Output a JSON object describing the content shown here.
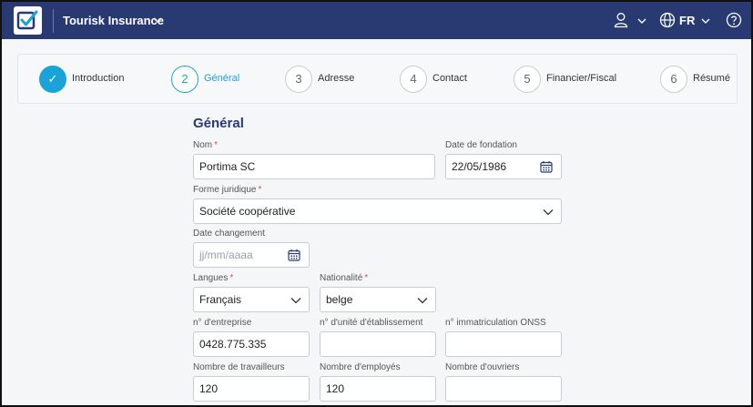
{
  "header": {
    "brand": "Tourisk Insurance",
    "language": "FR"
  },
  "stepper": {
    "steps": [
      {
        "number": "✓",
        "label": "Introduction",
        "state": "done"
      },
      {
        "number": "2",
        "label": "Général",
        "state": "active"
      },
      {
        "number": "3",
        "label": "Adresse",
        "state": "pending"
      },
      {
        "number": "4",
        "label": "Contact",
        "state": "pending"
      },
      {
        "number": "5",
        "label": "Financier/Fiscal",
        "state": "pending"
      },
      {
        "number": "6",
        "label": "Résumé",
        "state": "pending"
      }
    ]
  },
  "form": {
    "title": "Général",
    "required_marker": "*",
    "nom": {
      "label": "Nom",
      "value": "Portima SC"
    },
    "date_fondation": {
      "label": "Date de fondation",
      "value": "22/05/1986"
    },
    "forme_juridique": {
      "label": "Forme juridique",
      "value": "Société coopérative"
    },
    "date_changement": {
      "label": "Date changement",
      "placeholder": "jj/mm/aaaa"
    },
    "langues": {
      "label": "Langues",
      "value": "Français"
    },
    "nationalite": {
      "label": "Nationalité",
      "value": "belge"
    },
    "n_entreprise": {
      "label": "n° d'entreprise",
      "value": "0428.775.335"
    },
    "n_unite": {
      "label": "n° d'unité d'établissement",
      "value": ""
    },
    "n_onss": {
      "label": "n° immatriculation ONSS",
      "value": ""
    },
    "nb_travailleurs": {
      "label": "Nombre de travailleurs",
      "value": "120"
    },
    "nb_employes": {
      "label": "Nombre d'employés",
      "value": "120"
    },
    "nb_ouvriers": {
      "label": "Nombre d'ouvriers",
      "value": ""
    }
  },
  "colors": {
    "header_bg": "#293a73",
    "accent": "#1aa3d9",
    "required": "#d9534f"
  }
}
